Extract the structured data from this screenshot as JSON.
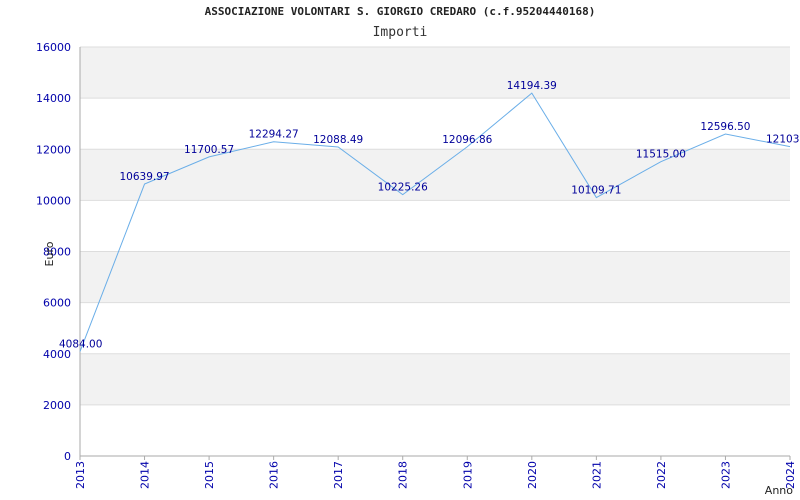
{
  "chart_data": {
    "type": "line",
    "title": "ASSOCIAZIONE VOLONTARI S. GIORGIO CREDARO (c.f.95204440168)",
    "subtitle": "Importi",
    "xlabel": "Anno",
    "ylabel": "Euro",
    "ylim": [
      0,
      16000
    ],
    "yticks": [
      0,
      2000,
      4000,
      6000,
      8000,
      10000,
      12000,
      14000,
      16000
    ],
    "grid": true,
    "categories": [
      "2013",
      "2014",
      "2015",
      "2016",
      "2017",
      "2018",
      "2019",
      "2020",
      "2021",
      "2022",
      "2023",
      "2024"
    ],
    "series": [
      {
        "values": [
          4084.0,
          10639.97,
          11700.57,
          12294.27,
          12088.49,
          10225.26,
          12096.86,
          14194.39,
          10109.71,
          11515.0,
          12596.5,
          12103.0
        ],
        "labels": [
          "4084.00",
          "10639.97",
          "11700.57",
          "12294.27",
          "12088.49",
          "10225.26",
          "12096.86",
          "14194.39",
          "10109.71",
          "11515.00",
          "12596.50",
          "12103."
        ]
      }
    ],
    "colors": {
      "line": "#6aaee8",
      "label": "#000099",
      "axis_tick": "#0000aa",
      "band_shaded": "#f2f2f2",
      "band_plain": "#ffffff",
      "grid": "#dddddd"
    }
  }
}
